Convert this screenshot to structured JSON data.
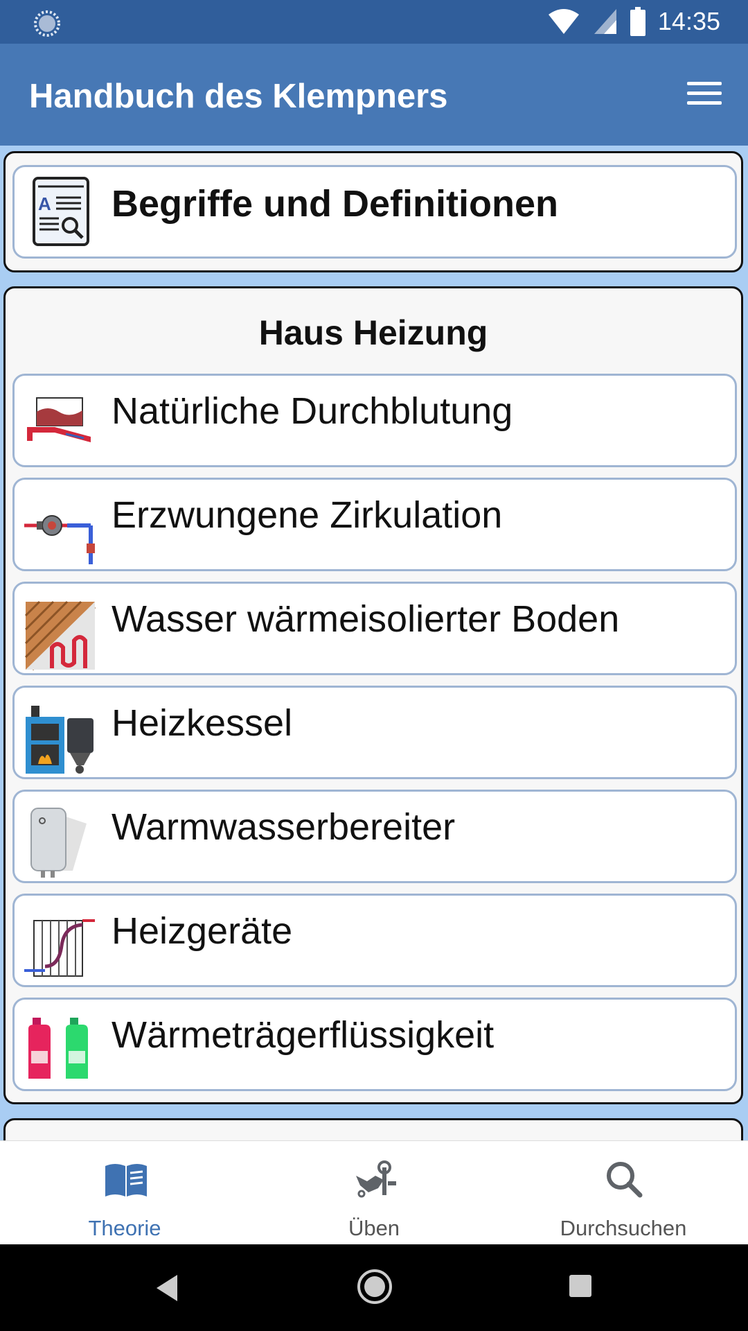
{
  "status_bar": {
    "time": "14:35"
  },
  "app_bar": {
    "title": "Handbuch des Klempners",
    "menu_icon": "hamburger-menu-icon"
  },
  "definitions_card": {
    "label": "Begriffe und Definitionen",
    "icon": "dictionary-icon"
  },
  "section": {
    "title": "Haus Heizung",
    "items": [
      {
        "label": "Natürliche Durchblutung",
        "icon": "natural-circulation-icon"
      },
      {
        "label": "Erzwungene Zirkulation",
        "icon": "circulation-pump-icon"
      },
      {
        "label": "Wasser wärmeisolierter Boden",
        "icon": "underfloor-heating-icon"
      },
      {
        "label": "Heizkessel",
        "icon": "boiler-icon"
      },
      {
        "label": "Warmwasserbereiter",
        "icon": "water-heater-icon"
      },
      {
        "label": "Heizgeräte",
        "icon": "radiator-icon"
      },
      {
        "label": "Wärmeträgerflüssigkeit",
        "icon": "coolant-bottles-icon"
      }
    ]
  },
  "bottom_nav": {
    "active": "Theorie",
    "items": [
      {
        "label": "Theorie",
        "icon": "book-icon"
      },
      {
        "label": "Üben",
        "icon": "tools-icon"
      },
      {
        "label": "Durchsuchen",
        "icon": "search-icon"
      }
    ]
  },
  "colors": {
    "accent": "#4778b5",
    "status_bar": "#305e9b",
    "background": "#a9cdf3"
  }
}
